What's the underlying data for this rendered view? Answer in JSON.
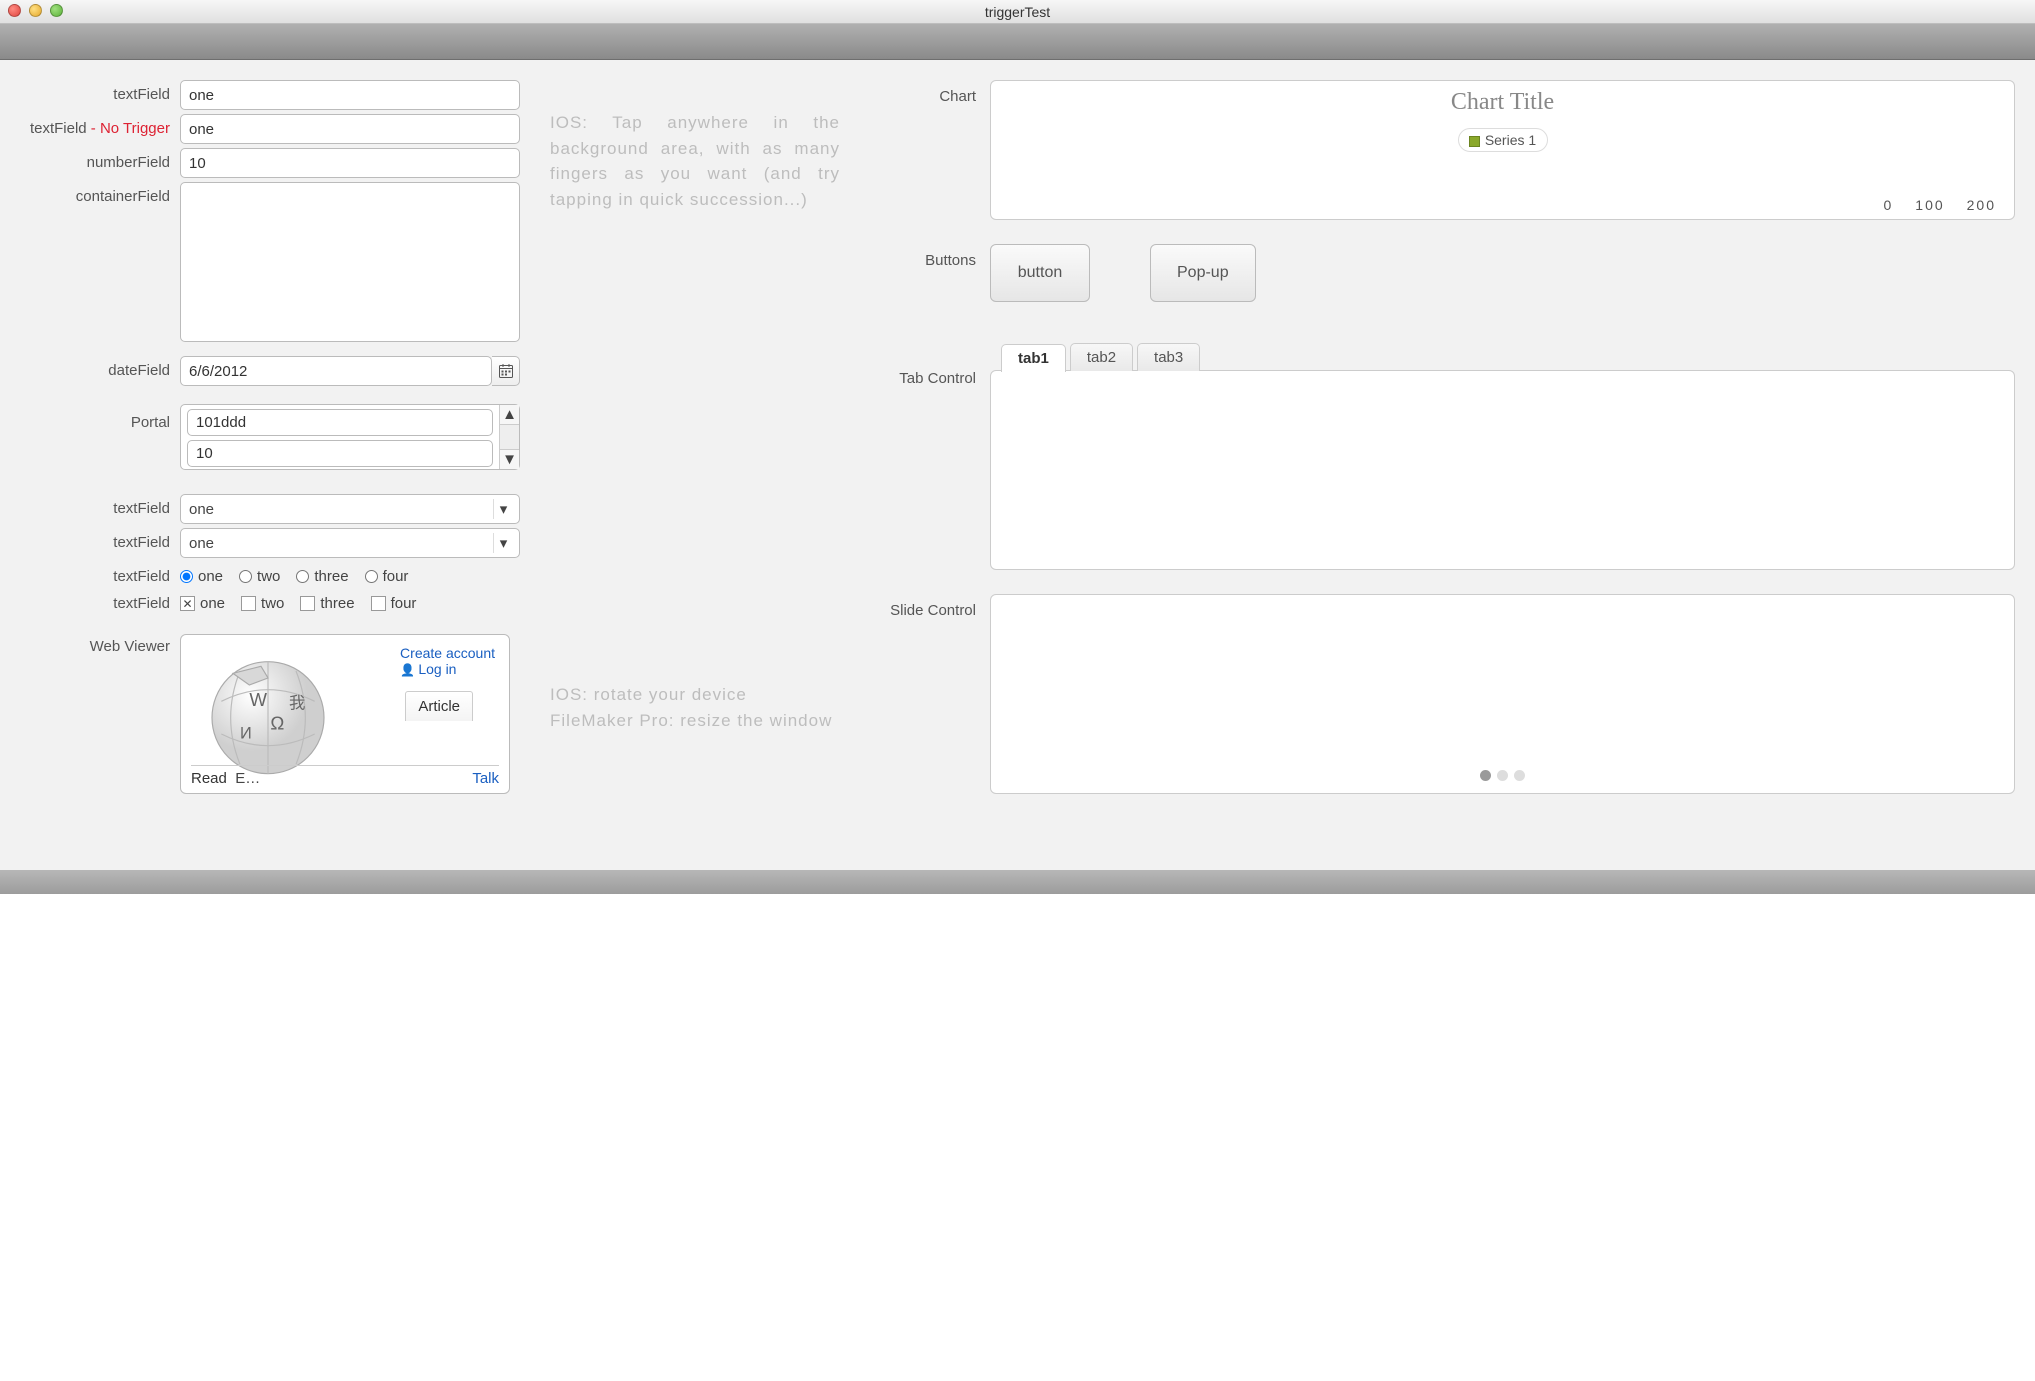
{
  "window": {
    "title": "triggerTest"
  },
  "labels": {
    "textField": "textField",
    "textFieldNoTrigger_pre": "textField ",
    "textFieldNoTrigger_red": "- No Trigger",
    "numberField": "numberField",
    "containerField": "containerField",
    "dateField": "dateField",
    "portal": "Portal",
    "webViewer": "Web Viewer",
    "chart": "Chart",
    "buttons": "Buttons",
    "tabControl": "Tab Control",
    "slideControl": "Slide Control"
  },
  "fields": {
    "textField1": "one",
    "textField2": "one",
    "numberField": "10",
    "dateField": "6/6/2012",
    "portal": {
      "rows": [
        "101ddd",
        "10"
      ]
    },
    "dropdown1": "one",
    "dropdown2": "one",
    "radioOptions": [
      "one",
      "two",
      "three",
      "four"
    ],
    "radioSelected": "one",
    "checkOptions": [
      "one",
      "two",
      "three",
      "four"
    ],
    "checkSelected": [
      "one"
    ]
  },
  "webviewer": {
    "createAccount": "Create account",
    "login": "Log in",
    "article": "Article",
    "read": "Read",
    "edit": "E…",
    "talk": "Talk"
  },
  "hints": {
    "top": "IOS: Tap anywhere in the background area, with as many fingers as you want (and try tapping in quick succession...)",
    "bottom1": "IOS: rotate your device",
    "bottom2": "FileMaker Pro: resize the window"
  },
  "buttons": {
    "button": "button",
    "popup": "Pop-up"
  },
  "tabs": {
    "items": [
      "tab1",
      "tab2",
      "tab3"
    ],
    "active": 0
  },
  "slide": {
    "count": 3,
    "active": 0
  },
  "chart_data": {
    "type": "bar",
    "title": "Chart Title",
    "series": [
      {
        "name": "Series 1",
        "values": []
      }
    ],
    "x_ticks": [
      0,
      100,
      200
    ],
    "xlim": [
      0,
      200
    ]
  }
}
